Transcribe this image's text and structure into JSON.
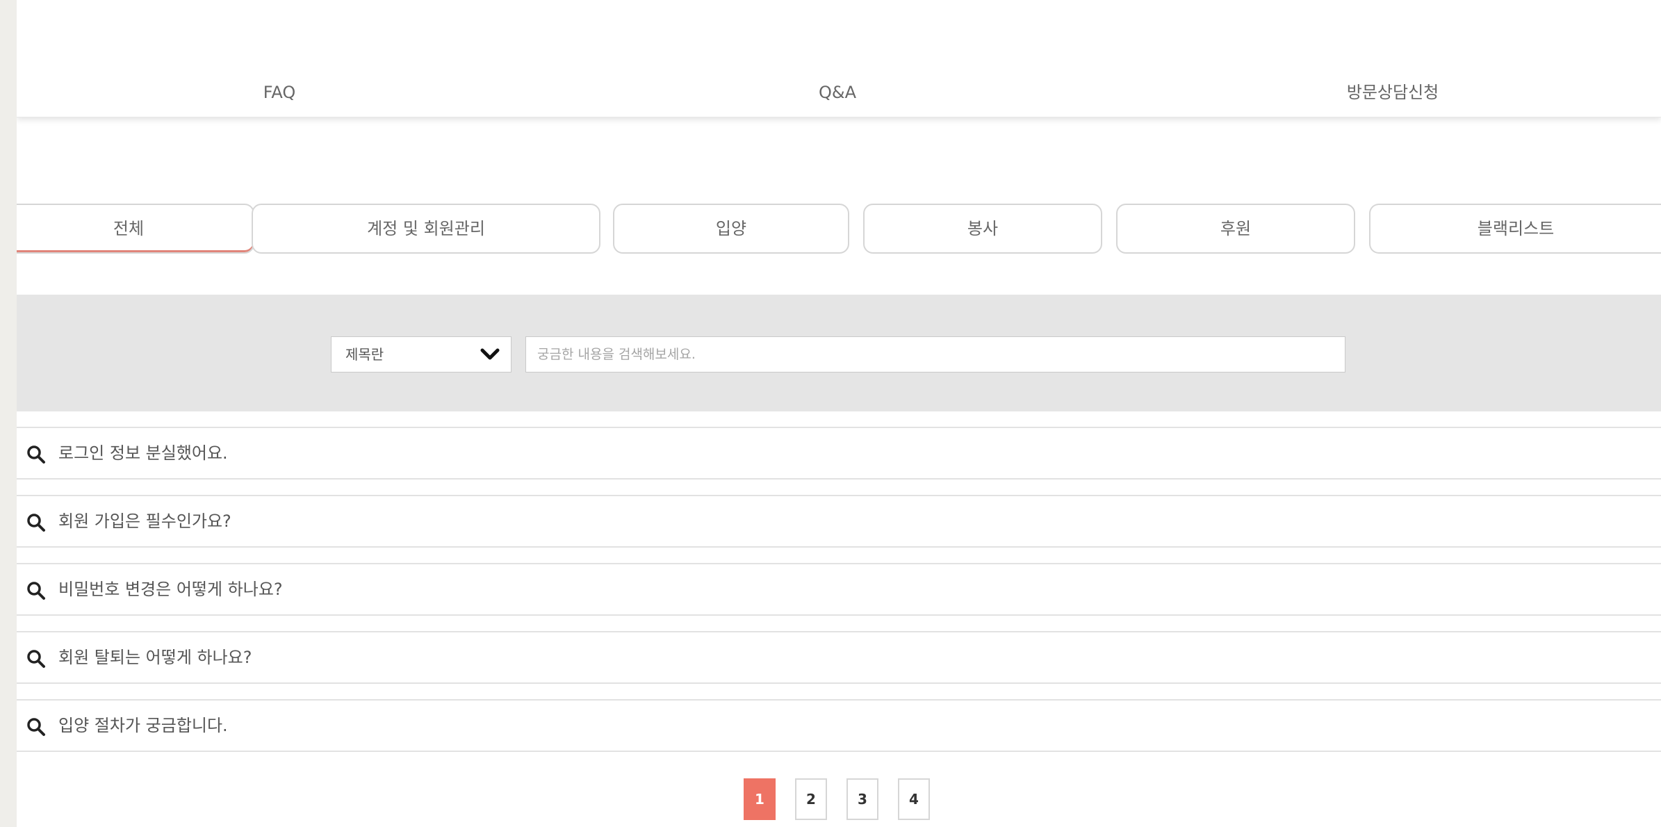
{
  "topnav": {
    "tabs": [
      {
        "label": "FAQ"
      },
      {
        "label": "Q&A"
      },
      {
        "label": "방문상담신청"
      }
    ]
  },
  "categories": [
    {
      "label": "전체",
      "active": true
    },
    {
      "label": "계정 및 회원관리"
    },
    {
      "label": "입양"
    },
    {
      "label": "봉사"
    },
    {
      "label": "후원"
    },
    {
      "label": "블랙리스트"
    }
  ],
  "search": {
    "select_value": "제목란",
    "placeholder": "궁금한 내용을 검색해보세요."
  },
  "faqs": [
    {
      "question": "로그인 정보 분실했어요."
    },
    {
      "question": "회원 가입은 필수인가요?"
    },
    {
      "question": "비밀번호 변경은 어떻게 하나요?"
    },
    {
      "question": "회원 탈퇴는 어떻게 하나요?"
    },
    {
      "question": "입양 절차가 궁금합니다."
    }
  ],
  "pagination": {
    "pages": [
      "1",
      "2",
      "3",
      "4"
    ],
    "current": "1"
  },
  "colors": {
    "accent": "#ee7364",
    "active_underline": "#e0857a",
    "search_band": "#e5e5e5"
  },
  "icons": {
    "faq_icon": "search-icon",
    "select_icon": "chevron-down-icon"
  }
}
